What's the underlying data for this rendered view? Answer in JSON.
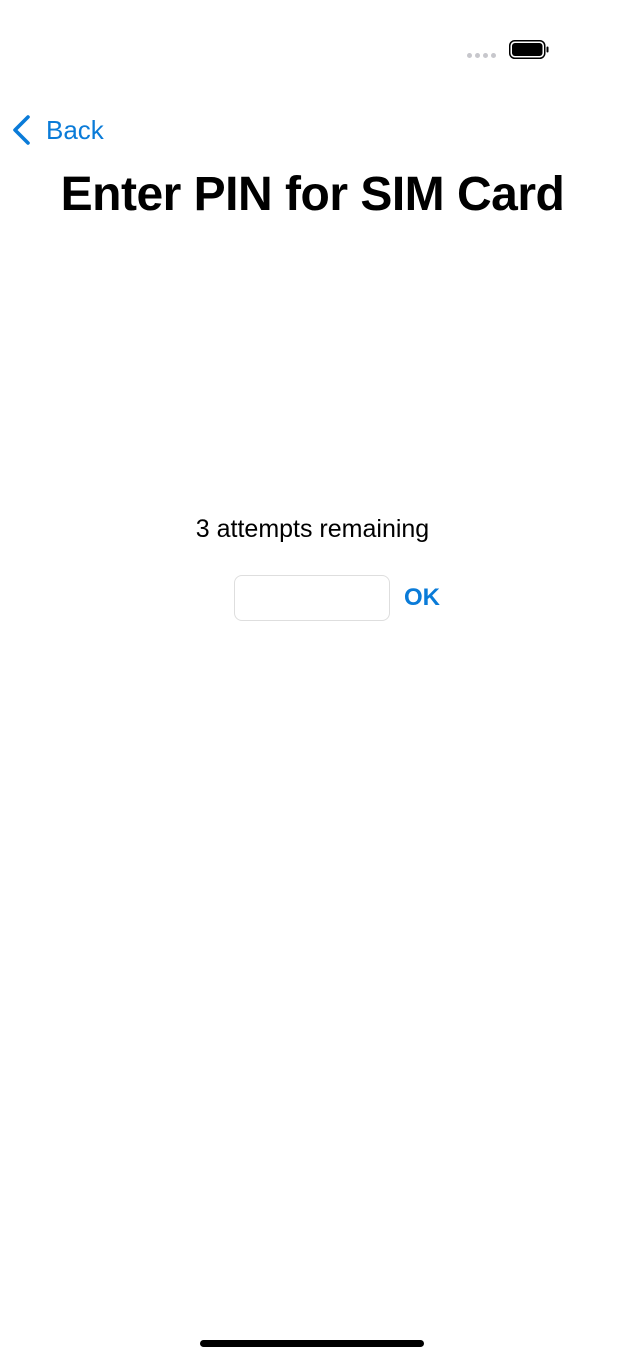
{
  "status_bar": {
    "signal_icon": "cellular-dots-icon",
    "battery_icon": "battery-full-icon"
  },
  "navigation": {
    "back_label": "Back",
    "back_icon": "chevron-left-icon",
    "accent_color": "#0a7bd8"
  },
  "page": {
    "title": "Enter PIN for SIM Card"
  },
  "pin_entry": {
    "attempts_text": "3 attempts remaining",
    "input_value": "",
    "ok_label": "OK"
  }
}
